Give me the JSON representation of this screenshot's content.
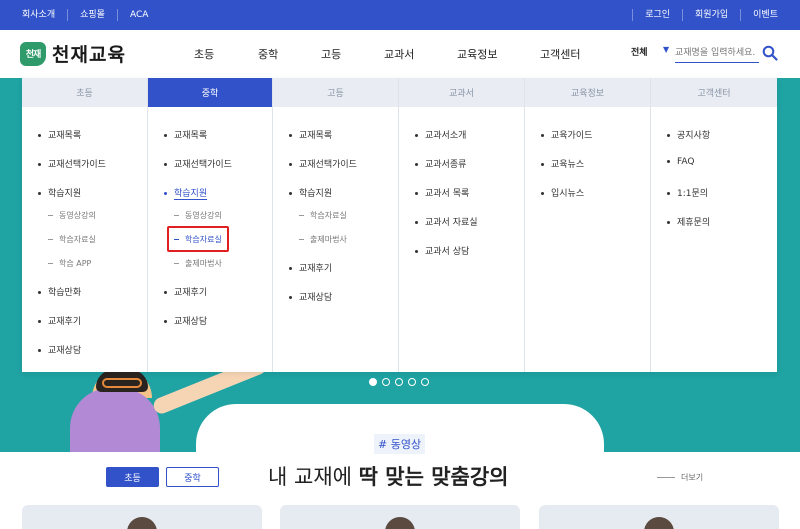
{
  "topbar": {
    "left_links": [
      "회사소개",
      "쇼핑몰",
      "ACA"
    ],
    "right_links": [
      "로그인",
      "회원가입",
      "이벤트"
    ]
  },
  "brand": {
    "logo_mark": "천재",
    "logo_text": "천재교육"
  },
  "gnb": [
    "초등",
    "중학",
    "고등",
    "교과서",
    "교육정보",
    "고객센터"
  ],
  "search": {
    "scope": "전체",
    "placeholder": "교재명을 입력하세요."
  },
  "menu": {
    "active_column": "중학",
    "columns": [
      {
        "title": "초등",
        "items": [
          {
            "label": "교재목록"
          },
          {
            "label": "교재선택가이드"
          },
          {
            "label": "학습지원",
            "subs": [
              "동영상강의",
              "학습자료실",
              "학습 APP"
            ]
          },
          {
            "label": "학습만화"
          },
          {
            "label": "교재후기"
          },
          {
            "label": "교재상담"
          }
        ]
      },
      {
        "title": "중학",
        "items": [
          {
            "label": "교재목록"
          },
          {
            "label": "교재선택가이드"
          },
          {
            "label": "학습지원",
            "selected": true,
            "subs": [
              "동영상강의",
              "학습자료실",
              "출제마법사"
            ],
            "selected_sub": "학습자료실"
          },
          {
            "label": "교재후기"
          },
          {
            "label": "교재상담"
          }
        ]
      },
      {
        "title": "고등",
        "items": [
          {
            "label": "교재목록"
          },
          {
            "label": "교재선택가이드"
          },
          {
            "label": "학습지원",
            "subs": [
              "학습자료실",
              "출제마법사"
            ]
          },
          {
            "label": "교재후기"
          },
          {
            "label": "교재상담"
          }
        ]
      },
      {
        "title": "교과서",
        "items": [
          {
            "label": "교과서소개"
          },
          {
            "label": "교과서종류"
          },
          {
            "label": "교과서 목록"
          },
          {
            "label": "교과서 자료실"
          },
          {
            "label": "교과서 상담"
          }
        ]
      },
      {
        "title": "교육정보",
        "items": [
          {
            "label": "교육가이드"
          },
          {
            "label": "교육뉴스"
          },
          {
            "label": "입시뉴스"
          }
        ]
      },
      {
        "title": "고객센터",
        "items": [
          {
            "label": "공지사항"
          },
          {
            "label": "FAQ"
          },
          {
            "label": "1:1문의"
          },
          {
            "label": "제휴문의"
          }
        ]
      }
    ]
  },
  "carousel": {
    "count": 5,
    "active_index": 0
  },
  "lecture_section": {
    "tag": "# 동영상",
    "tabs": [
      "초등",
      "중학"
    ],
    "active_tab": "초등",
    "title_plain": "내 교재에 ",
    "title_bold": "딱 맞는 맞춤강의",
    "more": "더보기"
  },
  "colors": {
    "brand_blue": "#3152c9",
    "logo_green": "#2f9a6a",
    "hero_teal": "#1fa3a3",
    "highlight_red": "#e02020"
  }
}
